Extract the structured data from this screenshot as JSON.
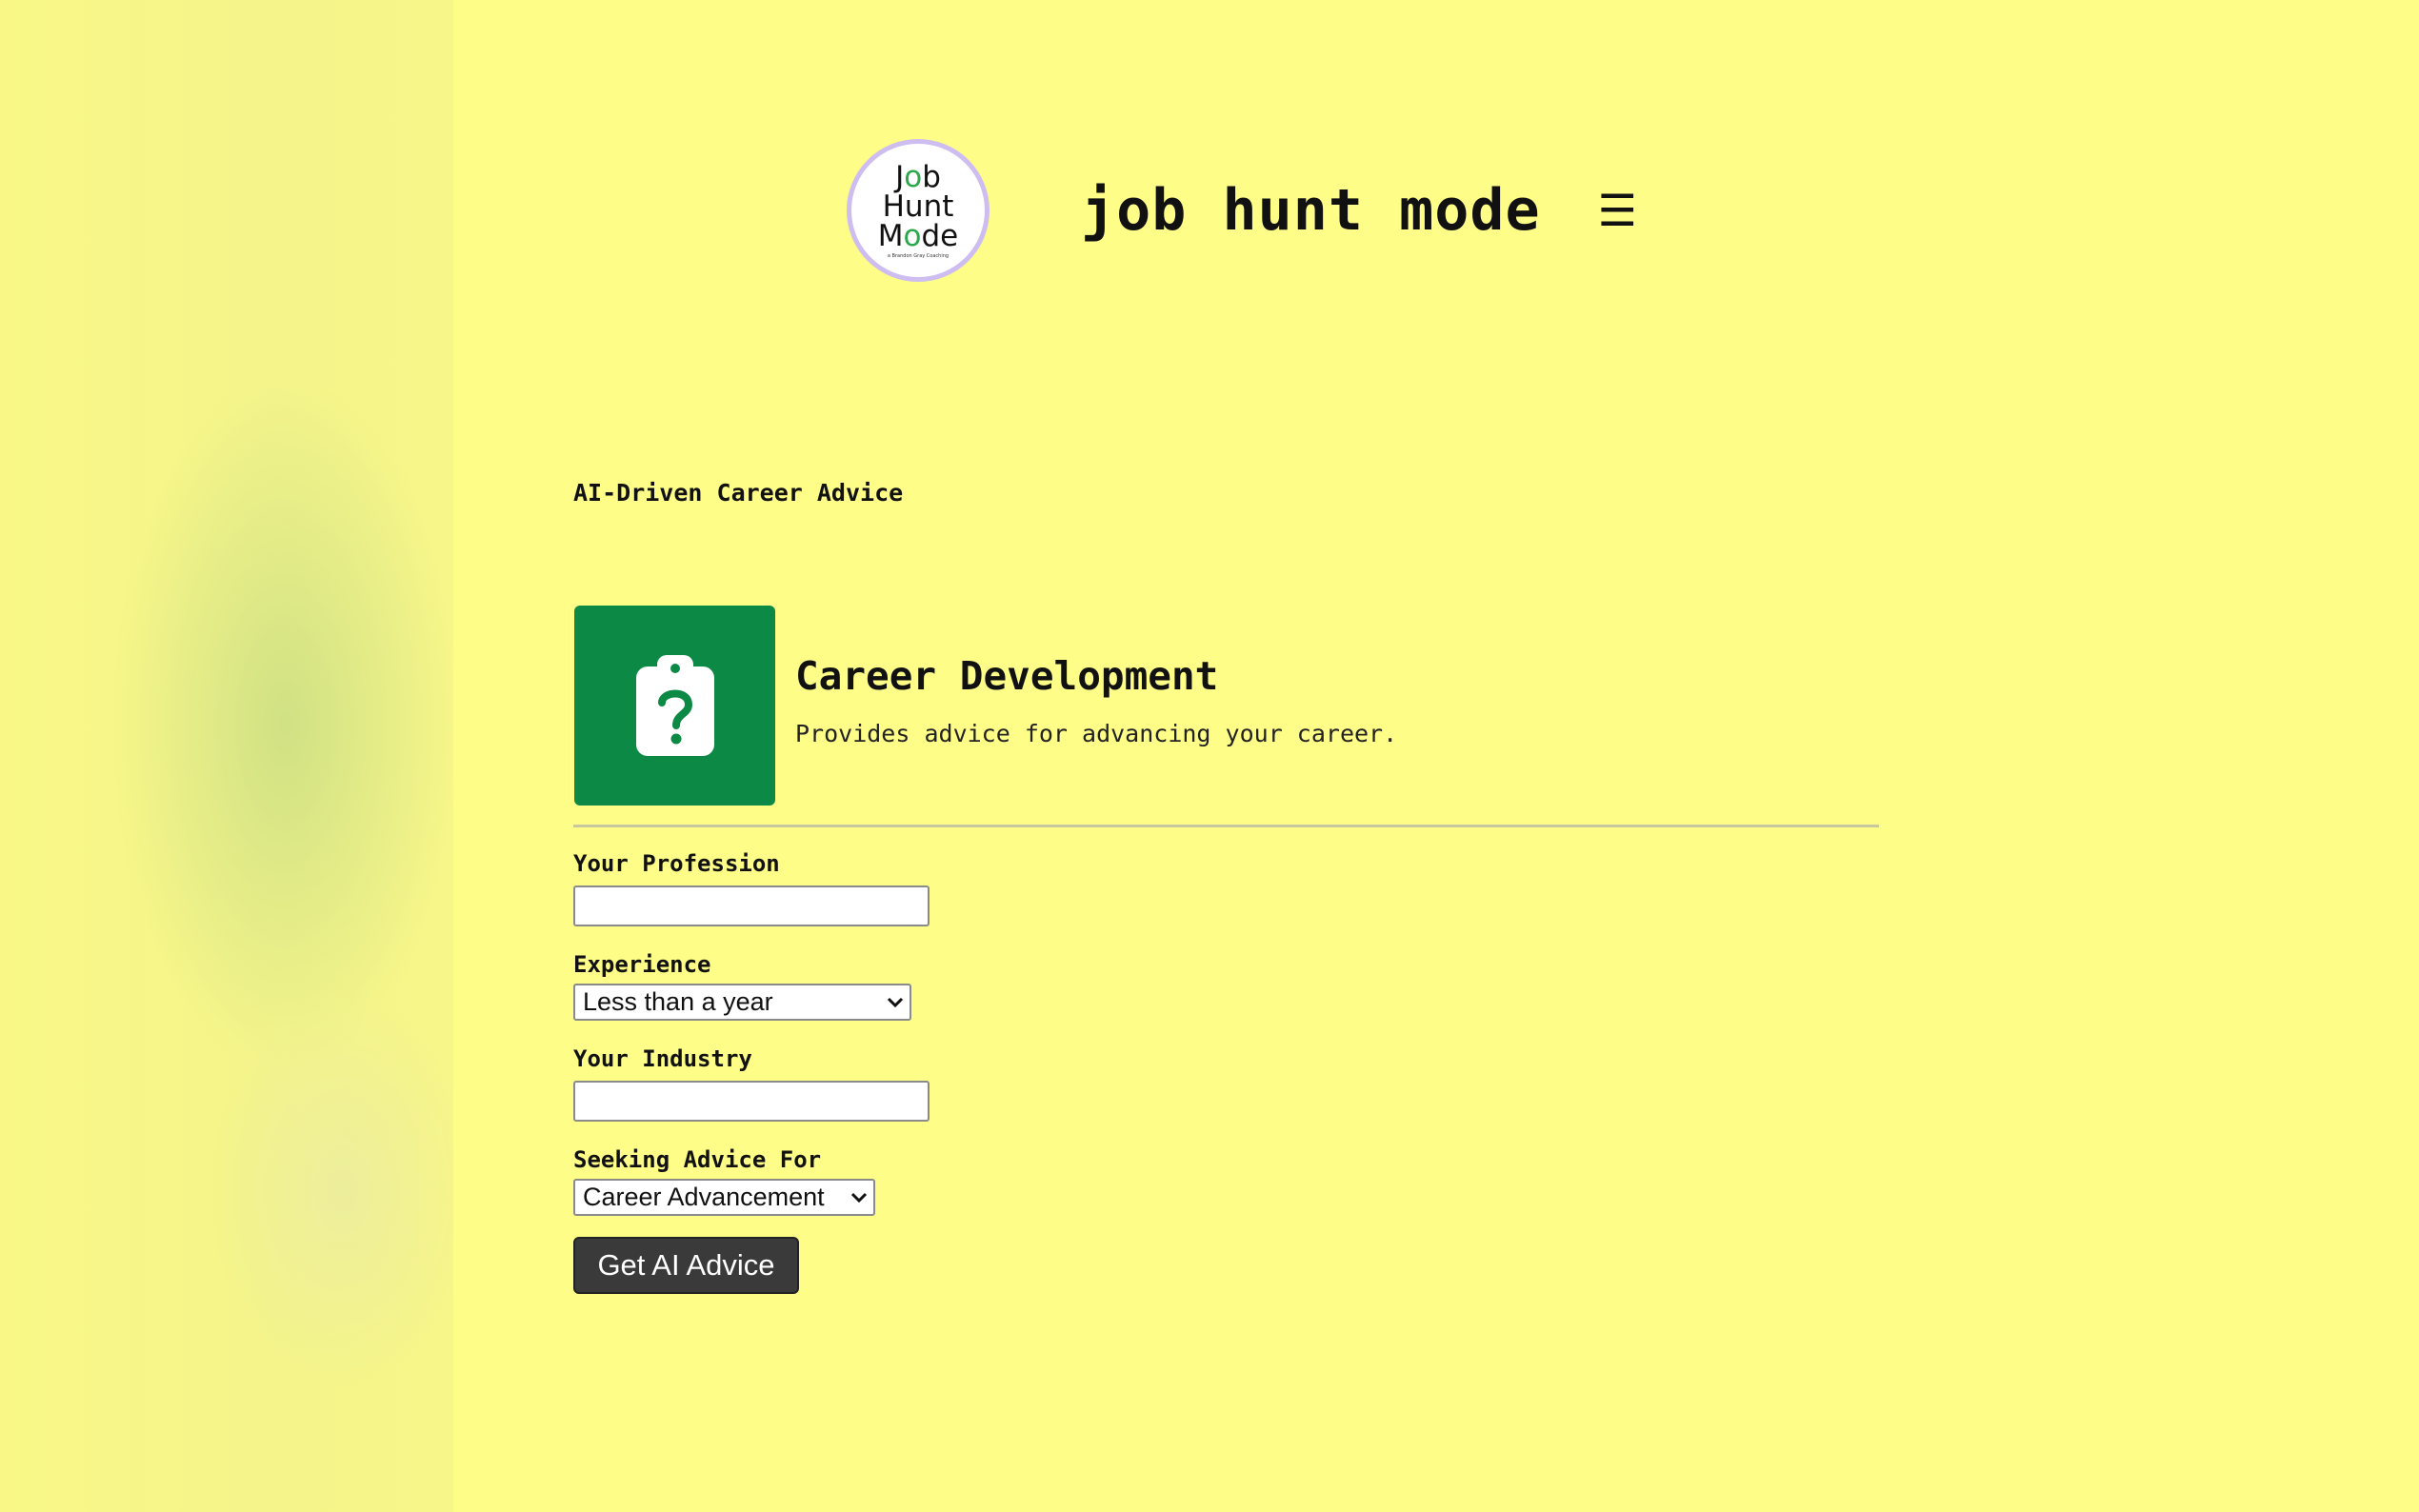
{
  "header": {
    "logo_lines": [
      "Job",
      "Hunt",
      "Mode"
    ],
    "logo_small_text": "a Brandon Gray Coaching",
    "title": "job hunt mode",
    "menu_icon": "hamburger-icon",
    "menu_glyph": "☰"
  },
  "section": {
    "label": "AI-Driven Career Advice"
  },
  "card": {
    "icon": "clipboard-question-icon",
    "title": "Career Development",
    "description": "Provides advice for advancing your career."
  },
  "form": {
    "profession_label": "Your Profession",
    "profession_value": "",
    "experience_label": "Experience",
    "experience_selected": "Less than a year",
    "industry_label": "Your Industry",
    "industry_value": "",
    "advice_label": "Seeking Advice For",
    "advice_selected": "Career Advancement",
    "submit_label": "Get AI Advice"
  },
  "colors": {
    "background": "#fefd88",
    "card_icon_bg": "#0c8a45",
    "button_bg": "#3a3a3a",
    "logo_ring": "#cdbdf0",
    "logo_accent": "#2aa84a"
  }
}
